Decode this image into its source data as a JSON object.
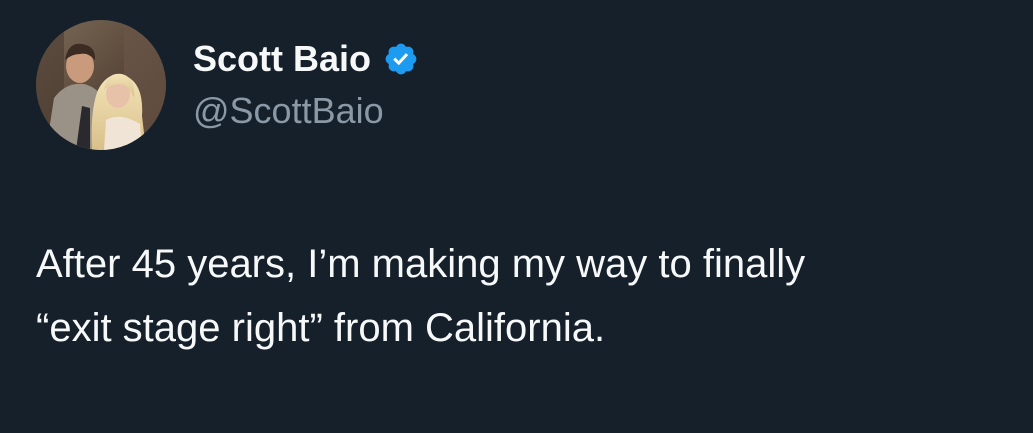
{
  "author": {
    "display_name": "Scott Baio",
    "handle": "@ScottBaio",
    "verified_icon": "verified-badge-icon",
    "avatar_icon": "profile-photo"
  },
  "tweet": {
    "lines": [
      "After 45 years, I’m making my way to finally",
      "“exit stage right” from California."
    ]
  },
  "colors": {
    "background": "#15202b",
    "text": "#f7f9f9",
    "secondary_text": "#8b98a5",
    "verified_blue": "#1d9bf0"
  }
}
